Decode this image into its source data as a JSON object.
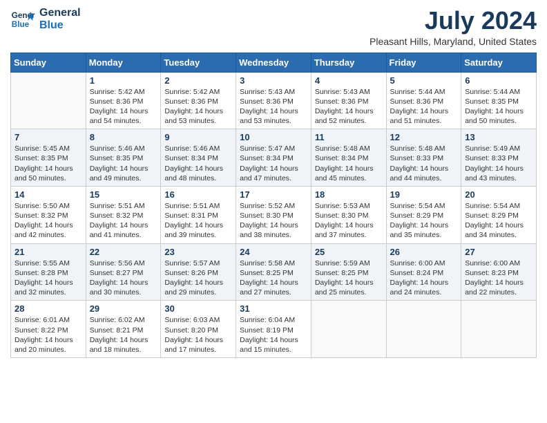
{
  "header": {
    "logo_line1": "General",
    "logo_line2": "Blue",
    "month_year": "July 2024",
    "location": "Pleasant Hills, Maryland, United States"
  },
  "weekdays": [
    "Sunday",
    "Monday",
    "Tuesday",
    "Wednesday",
    "Thursday",
    "Friday",
    "Saturday"
  ],
  "weeks": [
    [
      {
        "day": "",
        "text": ""
      },
      {
        "day": "1",
        "text": "Sunrise: 5:42 AM\nSunset: 8:36 PM\nDaylight: 14 hours\nand 54 minutes."
      },
      {
        "day": "2",
        "text": "Sunrise: 5:42 AM\nSunset: 8:36 PM\nDaylight: 14 hours\nand 53 minutes."
      },
      {
        "day": "3",
        "text": "Sunrise: 5:43 AM\nSunset: 8:36 PM\nDaylight: 14 hours\nand 53 minutes."
      },
      {
        "day": "4",
        "text": "Sunrise: 5:43 AM\nSunset: 8:36 PM\nDaylight: 14 hours\nand 52 minutes."
      },
      {
        "day": "5",
        "text": "Sunrise: 5:44 AM\nSunset: 8:36 PM\nDaylight: 14 hours\nand 51 minutes."
      },
      {
        "day": "6",
        "text": "Sunrise: 5:44 AM\nSunset: 8:35 PM\nDaylight: 14 hours\nand 50 minutes."
      }
    ],
    [
      {
        "day": "7",
        "text": "Sunrise: 5:45 AM\nSunset: 8:35 PM\nDaylight: 14 hours\nand 50 minutes."
      },
      {
        "day": "8",
        "text": "Sunrise: 5:46 AM\nSunset: 8:35 PM\nDaylight: 14 hours\nand 49 minutes."
      },
      {
        "day": "9",
        "text": "Sunrise: 5:46 AM\nSunset: 8:34 PM\nDaylight: 14 hours\nand 48 minutes."
      },
      {
        "day": "10",
        "text": "Sunrise: 5:47 AM\nSunset: 8:34 PM\nDaylight: 14 hours\nand 47 minutes."
      },
      {
        "day": "11",
        "text": "Sunrise: 5:48 AM\nSunset: 8:34 PM\nDaylight: 14 hours\nand 45 minutes."
      },
      {
        "day": "12",
        "text": "Sunrise: 5:48 AM\nSunset: 8:33 PM\nDaylight: 14 hours\nand 44 minutes."
      },
      {
        "day": "13",
        "text": "Sunrise: 5:49 AM\nSunset: 8:33 PM\nDaylight: 14 hours\nand 43 minutes."
      }
    ],
    [
      {
        "day": "14",
        "text": "Sunrise: 5:50 AM\nSunset: 8:32 PM\nDaylight: 14 hours\nand 42 minutes."
      },
      {
        "day": "15",
        "text": "Sunrise: 5:51 AM\nSunset: 8:32 PM\nDaylight: 14 hours\nand 41 minutes."
      },
      {
        "day": "16",
        "text": "Sunrise: 5:51 AM\nSunset: 8:31 PM\nDaylight: 14 hours\nand 39 minutes."
      },
      {
        "day": "17",
        "text": "Sunrise: 5:52 AM\nSunset: 8:30 PM\nDaylight: 14 hours\nand 38 minutes."
      },
      {
        "day": "18",
        "text": "Sunrise: 5:53 AM\nSunset: 8:30 PM\nDaylight: 14 hours\nand 37 minutes."
      },
      {
        "day": "19",
        "text": "Sunrise: 5:54 AM\nSunset: 8:29 PM\nDaylight: 14 hours\nand 35 minutes."
      },
      {
        "day": "20",
        "text": "Sunrise: 5:54 AM\nSunset: 8:29 PM\nDaylight: 14 hours\nand 34 minutes."
      }
    ],
    [
      {
        "day": "21",
        "text": "Sunrise: 5:55 AM\nSunset: 8:28 PM\nDaylight: 14 hours\nand 32 minutes."
      },
      {
        "day": "22",
        "text": "Sunrise: 5:56 AM\nSunset: 8:27 PM\nDaylight: 14 hours\nand 30 minutes."
      },
      {
        "day": "23",
        "text": "Sunrise: 5:57 AM\nSunset: 8:26 PM\nDaylight: 14 hours\nand 29 minutes."
      },
      {
        "day": "24",
        "text": "Sunrise: 5:58 AM\nSunset: 8:25 PM\nDaylight: 14 hours\nand 27 minutes."
      },
      {
        "day": "25",
        "text": "Sunrise: 5:59 AM\nSunset: 8:25 PM\nDaylight: 14 hours\nand 25 minutes."
      },
      {
        "day": "26",
        "text": "Sunrise: 6:00 AM\nSunset: 8:24 PM\nDaylight: 14 hours\nand 24 minutes."
      },
      {
        "day": "27",
        "text": "Sunrise: 6:00 AM\nSunset: 8:23 PM\nDaylight: 14 hours\nand 22 minutes."
      }
    ],
    [
      {
        "day": "28",
        "text": "Sunrise: 6:01 AM\nSunset: 8:22 PM\nDaylight: 14 hours\nand 20 minutes."
      },
      {
        "day": "29",
        "text": "Sunrise: 6:02 AM\nSunset: 8:21 PM\nDaylight: 14 hours\nand 18 minutes."
      },
      {
        "day": "30",
        "text": "Sunrise: 6:03 AM\nSunset: 8:20 PM\nDaylight: 14 hours\nand 17 minutes."
      },
      {
        "day": "31",
        "text": "Sunrise: 6:04 AM\nSunset: 8:19 PM\nDaylight: 14 hours\nand 15 minutes."
      },
      {
        "day": "",
        "text": ""
      },
      {
        "day": "",
        "text": ""
      },
      {
        "day": "",
        "text": ""
      }
    ]
  ]
}
